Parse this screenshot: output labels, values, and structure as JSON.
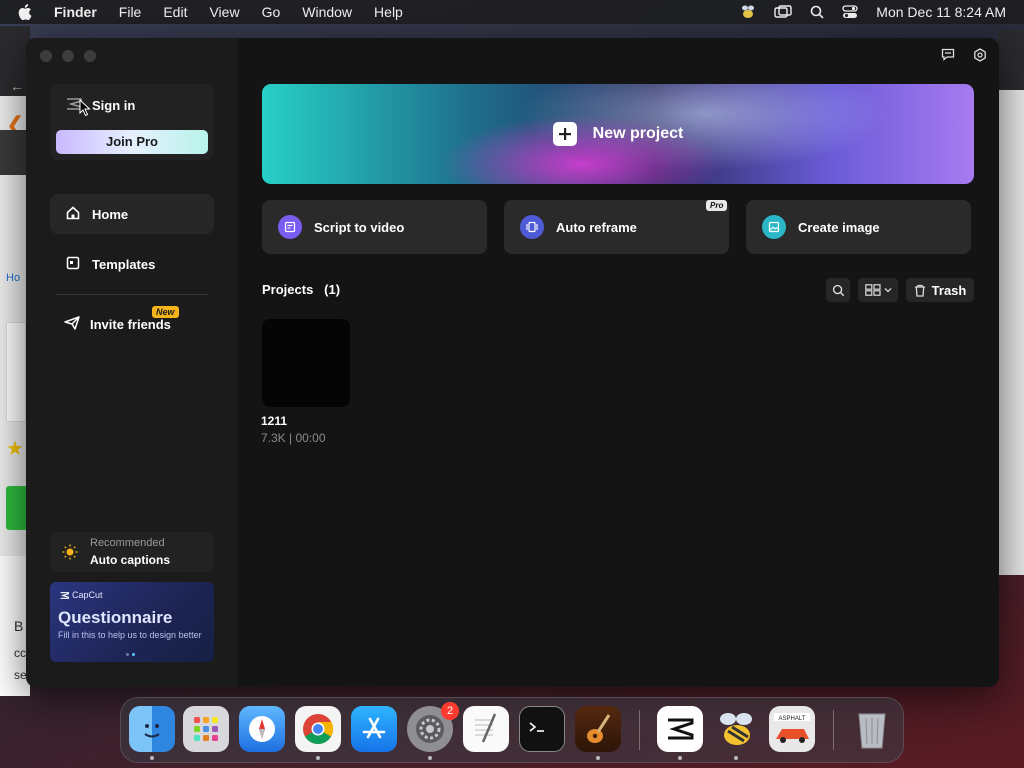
{
  "menubar": {
    "app_name": "Finder",
    "items": [
      "File",
      "Edit",
      "View",
      "Go",
      "Window",
      "Help"
    ],
    "clock": "Mon Dec 11  8:24 AM"
  },
  "sidebar": {
    "sign_in": "Sign in",
    "join_pro": "Join Pro",
    "nav": {
      "home": "Home",
      "templates": "Templates",
      "invite": "Invite friends",
      "invite_badge": "New"
    },
    "recommended": {
      "caption": "Recommended",
      "title": "Auto captions"
    },
    "questionnaire": {
      "brand": "CapCut",
      "title": "Questionnaire",
      "subtitle": "Fill in this to help us to design better"
    }
  },
  "main": {
    "new_project": "New project",
    "quick_actions": [
      {
        "label": "Script to video",
        "icon": "script-icon",
        "color": "#7b5cf0"
      },
      {
        "label": "Auto reframe",
        "icon": "reframe-icon",
        "color": "#4f5bd5",
        "badge": "Pro"
      },
      {
        "label": "Create image",
        "icon": "image-icon",
        "color": "#2bb7c7"
      }
    ],
    "projects_header": "Projects   (1)",
    "trash": "Trash",
    "projects": [
      {
        "name": "1211",
        "meta": "7.3K | 00:00"
      }
    ]
  },
  "dock": {
    "apps": [
      "Finder",
      "Launchpad",
      "Safari",
      "Chrome",
      "App Store",
      "System Settings",
      "TextEdit",
      "Terminal",
      "GarageBand",
      "CapCut",
      "Bee",
      "Asphalt",
      "Trash"
    ],
    "settings_badge": "2"
  },
  "background": {
    "left_link_text": "Ho",
    "left_bottom": [
      "B",
      "cc",
      "se"
    ]
  }
}
